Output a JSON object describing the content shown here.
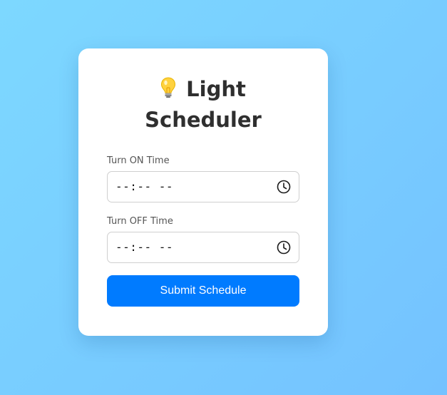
{
  "header": {
    "title": "Light Scheduler",
    "icon": "light-bulb-icon"
  },
  "form": {
    "on_time": {
      "label": "Turn ON Time",
      "value": "--:-- --",
      "icon": "clock-icon"
    },
    "off_time": {
      "label": "Turn OFF Time",
      "value": "--:-- --",
      "icon": "clock-icon"
    },
    "submit_label": "Submit Schedule"
  },
  "colors": {
    "background_start": "#7dd8ff",
    "background_end": "#74c2ff",
    "card": "#ffffff",
    "accent": "#007bff",
    "title_text": "#2f2f2f"
  }
}
